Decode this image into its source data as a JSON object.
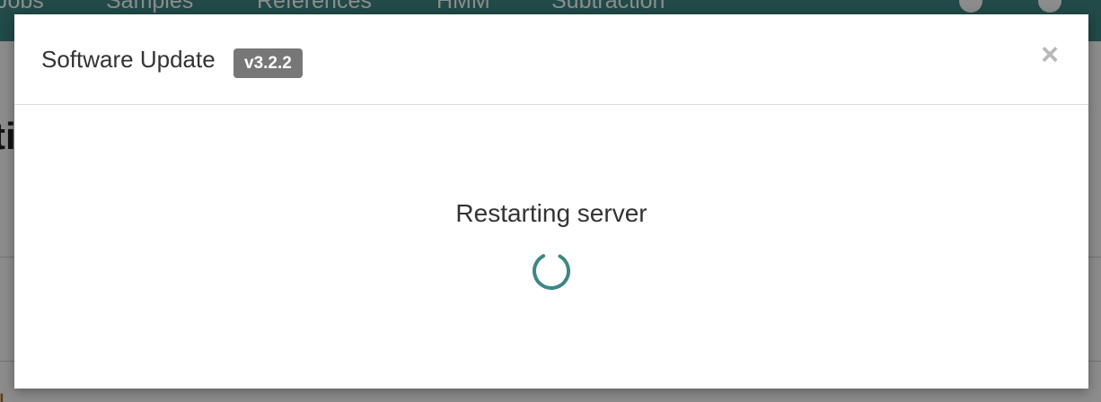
{
  "background": {
    "nav_items": [
      "Jobs",
      "Samples",
      "References",
      "HMM",
      "Subtraction"
    ],
    "heading_fragment": "ti",
    "navbar_color": "#3c8786"
  },
  "modal": {
    "title": "Software Update",
    "version_badge": "v3.2.2",
    "close_icon": "close-icon",
    "close_glyph": "×",
    "status_text": "Restarting server",
    "spinner_icon": "loading-spinner-icon",
    "accent_color": "#3c8786"
  }
}
